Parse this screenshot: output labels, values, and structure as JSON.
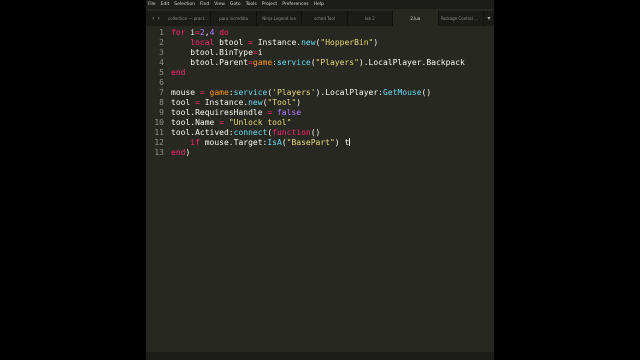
{
  "menu": [
    "File",
    "Edit",
    "Selection",
    "Find",
    "View",
    "Goto",
    "Tools",
    "Project",
    "Preferences",
    "Help"
  ],
  "tabs": [
    {
      "label": "collection — practice starter st"
    },
    {
      "label": "para incrediba"
    },
    {
      "label": "Ninja Legend.lua"
    },
    {
      "label": "sched Tool"
    },
    {
      "label": "lab 2"
    },
    {
      "label": "2.lua",
      "active": true
    },
    {
      "label": "Package Control Messages"
    }
  ],
  "code_lines": [
    {
      "num": "1",
      "tokens": [
        {
          "t": "for",
          "c": "kw"
        },
        {
          "t": " i",
          "c": "plain"
        },
        {
          "t": "=",
          "c": "kw"
        },
        {
          "t": "2",
          "c": "num"
        },
        {
          "t": ",",
          "c": "plain"
        },
        {
          "t": "4",
          "c": "num"
        },
        {
          "t": " do",
          "c": "kw"
        }
      ]
    },
    {
      "num": "2",
      "tokens": [
        {
          "t": "    local",
          "c": "kw"
        },
        {
          "t": " btool ",
          "c": "plain"
        },
        {
          "t": "=",
          "c": "kw"
        },
        {
          "t": " Instance",
          "c": "plain"
        },
        {
          "t": ".",
          "c": "plain"
        },
        {
          "t": "new",
          "c": "fn"
        },
        {
          "t": "(",
          "c": "plain"
        },
        {
          "t": "\"HopperBin\"",
          "c": "str"
        },
        {
          "t": ")",
          "c": "plain"
        }
      ]
    },
    {
      "num": "3",
      "tokens": [
        {
          "t": "    btool.BinType",
          "c": "plain"
        },
        {
          "t": "=",
          "c": "kw"
        },
        {
          "t": "i",
          "c": "plain"
        }
      ]
    },
    {
      "num": "4",
      "tokens": [
        {
          "t": "    btool.Parent",
          "c": "plain"
        },
        {
          "t": "=",
          "c": "kw"
        },
        {
          "t": "game",
          "c": "var"
        },
        {
          "t": ":",
          "c": "plain"
        },
        {
          "t": "service",
          "c": "fn"
        },
        {
          "t": "(",
          "c": "plain"
        },
        {
          "t": "\"Players\"",
          "c": "str"
        },
        {
          "t": ").LocalPlayer.Backpack",
          "c": "plain"
        }
      ]
    },
    {
      "num": "5",
      "tokens": [
        {
          "t": "end",
          "c": "kw"
        }
      ]
    },
    {
      "num": "6",
      "tokens": []
    },
    {
      "num": "7",
      "tokens": [
        {
          "t": "mouse ",
          "c": "plain"
        },
        {
          "t": "=",
          "c": "kw"
        },
        {
          "t": " game",
          "c": "var"
        },
        {
          "t": ":",
          "c": "plain"
        },
        {
          "t": "service",
          "c": "fn"
        },
        {
          "t": "(",
          "c": "plain"
        },
        {
          "t": "'Players'",
          "c": "str"
        },
        {
          "t": ").LocalPlayer:",
          "c": "plain"
        },
        {
          "t": "GetMouse",
          "c": "fn"
        },
        {
          "t": "()",
          "c": "plain"
        }
      ]
    },
    {
      "num": "8",
      "tokens": [
        {
          "t": "tool ",
          "c": "plain"
        },
        {
          "t": "=",
          "c": "kw"
        },
        {
          "t": " Instance",
          "c": "plain"
        },
        {
          "t": ".",
          "c": "plain"
        },
        {
          "t": "new",
          "c": "fn"
        },
        {
          "t": "(",
          "c": "plain"
        },
        {
          "t": "\"Tool\"",
          "c": "str"
        },
        {
          "t": ")",
          "c": "plain"
        }
      ]
    },
    {
      "num": "9",
      "tokens": [
        {
          "t": "tool.RequiresHandle ",
          "c": "plain"
        },
        {
          "t": "=",
          "c": "kw"
        },
        {
          "t": " false",
          "c": "num"
        }
      ]
    },
    {
      "num": "10",
      "tokens": [
        {
          "t": "tool.Name ",
          "c": "plain"
        },
        {
          "t": "=",
          "c": "kw"
        },
        {
          "t": " \"Unlock tool\"",
          "c": "str"
        }
      ]
    },
    {
      "num": "11",
      "tokens": [
        {
          "t": "tool.Actived:",
          "c": "plain"
        },
        {
          "t": "connect",
          "c": "fn"
        },
        {
          "t": "(",
          "c": "plain"
        },
        {
          "t": "function",
          "c": "kw"
        },
        {
          "t": "()",
          "c": "plain"
        }
      ]
    },
    {
      "num": "12",
      "tokens": [
        {
          "t": "    if",
          "c": "kw"
        },
        {
          "t": " mouse.Target:",
          "c": "plain"
        },
        {
          "t": "IsA",
          "c": "fn"
        },
        {
          "t": "(",
          "c": "plain"
        },
        {
          "t": "\"BasePart\"",
          "c": "str"
        },
        {
          "t": ") ",
          "c": "plain"
        },
        {
          "t": "t",
          "c": "plain"
        }
      ],
      "cursor": true
    },
    {
      "num": "13",
      "tokens": [
        {
          "t": "end",
          "c": "kw"
        },
        {
          "t": ")",
          "c": "plain"
        }
      ]
    }
  ],
  "colors": {
    "editor_bg": "#272822",
    "text": "#f8f8f2",
    "keyword": "#f92672",
    "string": "#e6db74",
    "number": "#ae81ff",
    "function": "#66d9ef",
    "variable": "#fd971f"
  },
  "icons": {
    "nav_left": "chevron-left-icon",
    "nav_right": "chevron-right-icon",
    "tab_overflow": "chevron-down-icon"
  }
}
